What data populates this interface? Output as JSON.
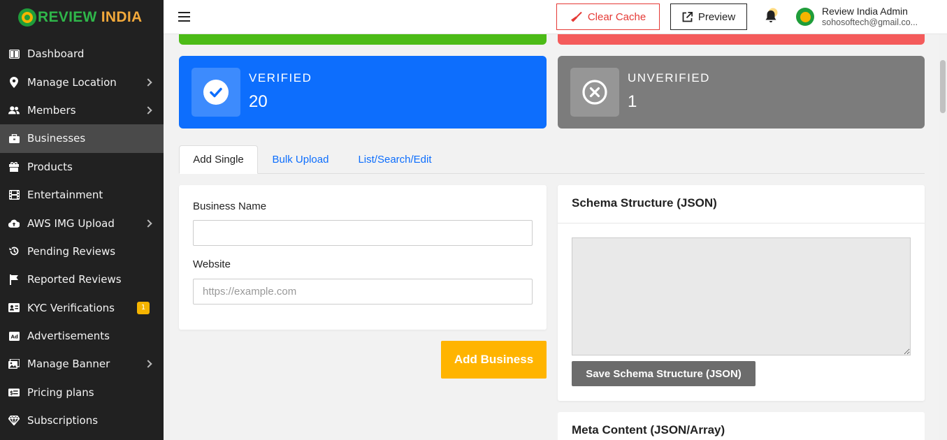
{
  "brand": {
    "part1": "REVIEW",
    "part2": "INDIA"
  },
  "sidebar": {
    "items": [
      {
        "label": "Dashboard",
        "icon": "dashboard-icon"
      },
      {
        "label": "Manage Location",
        "icon": "location-pin-icon"
      },
      {
        "label": "Members",
        "icon": "users-icon"
      },
      {
        "label": "Businesses",
        "icon": "briefcase-icon"
      },
      {
        "label": "Products",
        "icon": "gift-icon"
      },
      {
        "label": "Entertainment",
        "icon": "film-icon"
      },
      {
        "label": "AWS IMG Upload",
        "icon": "cloud-upload-icon"
      },
      {
        "label": "Pending Reviews",
        "icon": "history-icon"
      },
      {
        "label": "Reported Reviews",
        "icon": "flag-icon"
      },
      {
        "label": "KYC Verifications",
        "icon": "id-card-icon",
        "badge": "1"
      },
      {
        "label": "Advertisements",
        "icon": "ad-icon"
      },
      {
        "label": "Manage Banner",
        "icon": "image-icon"
      },
      {
        "label": "Pricing plans",
        "icon": "money-icon"
      },
      {
        "label": "Subscriptions",
        "icon": "gem-icon"
      }
    ]
  },
  "header": {
    "clear_cache": "Clear Cache",
    "preview": "Preview",
    "user_name": "Review India Admin",
    "user_email": "sohosoftech@gmail.co..."
  },
  "stats": {
    "verified_label": "VERIFIED",
    "verified_value": "20",
    "unverified_label": "UNVERIFIED",
    "unverified_value": "1"
  },
  "tabs": {
    "add_single": "Add Single",
    "bulk_upload": "Bulk Upload",
    "list_search_edit": "List/Search/Edit"
  },
  "form": {
    "business_name_label": "Business Name",
    "business_name_value": "",
    "website_label": "Website",
    "website_placeholder": "https://example.com",
    "add_business": "Add Business"
  },
  "schema": {
    "title": "Schema Structure (JSON)",
    "save_button": "Save Schema Structure (JSON)"
  },
  "meta": {
    "title": "Meta Content (JSON/Array)"
  },
  "colors": {
    "verified": "#0d6efd",
    "unverified": "#7c7c7c",
    "green_strip": "#4cbb17",
    "red_strip": "#f45b5b",
    "add_button": "#ffb400",
    "sidebar_bg": "#212121"
  }
}
